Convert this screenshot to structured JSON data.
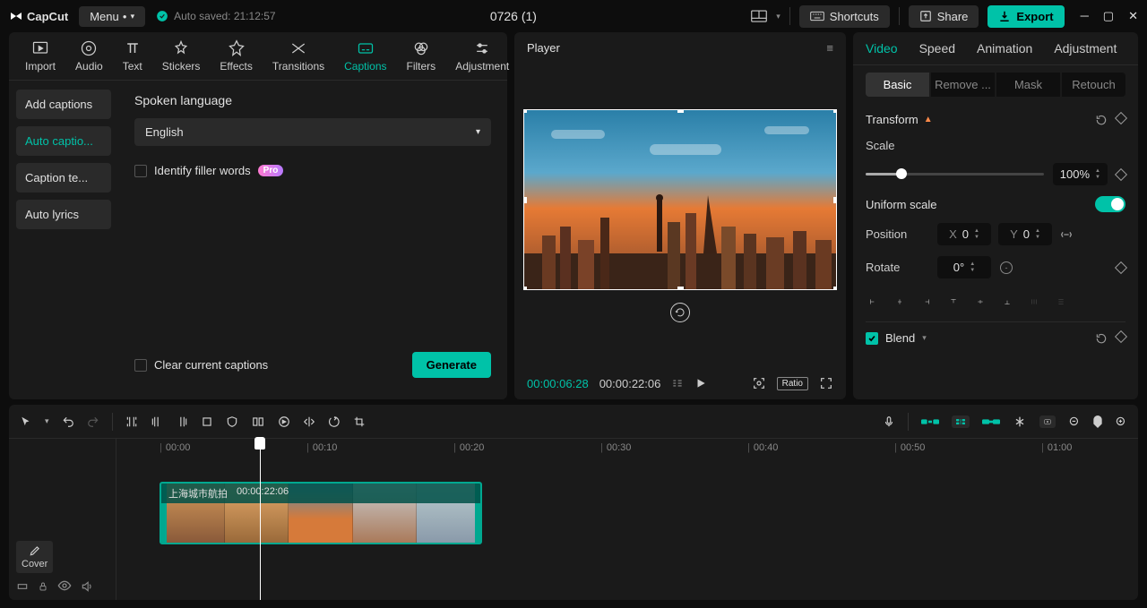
{
  "topbar": {
    "logo_text": "CapCut",
    "menu_label": "Menu",
    "autosave": "Auto saved: 21:12:57",
    "project_title": "0726 (1)",
    "shortcuts": "Shortcuts",
    "share": "Share",
    "export": "Export"
  },
  "media_tabs": [
    "Import",
    "Audio",
    "Text",
    "Stickers",
    "Effects",
    "Transitions",
    "Captions",
    "Filters",
    "Adjustment"
  ],
  "media_tabs_active_index": 6,
  "captions_sidebar": [
    {
      "label": "Add captions"
    },
    {
      "label": "Auto captio..."
    },
    {
      "label": "Caption te..."
    },
    {
      "label": "Auto lyrics"
    }
  ],
  "captions_sidebar_active_index": 1,
  "captions_panel": {
    "spoken_language_label": "Spoken language",
    "language_value": "English",
    "identify_filler_label": "Identify filler words",
    "pro_badge": "Pro",
    "clear_label": "Clear current captions",
    "generate_label": "Generate"
  },
  "player": {
    "title": "Player",
    "current_time": "00:00:06:28",
    "duration": "00:00:22:06",
    "ratio_label": "Ratio"
  },
  "right_tabs": [
    "Video",
    "Speed",
    "Animation",
    "Adjustment"
  ],
  "right_tabs_active_index": 0,
  "sub_tabs": [
    "Basic",
    "Remove ...",
    "Mask",
    "Retouch"
  ],
  "sub_tabs_active_index": 0,
  "transform": {
    "title": "Transform",
    "scale_label": "Scale",
    "scale_value": "100%",
    "uniform_label": "Uniform scale",
    "position_label": "Position",
    "x_label": "X",
    "x_value": "0",
    "y_label": "Y",
    "y_value": "0",
    "rotate_label": "Rotate",
    "rotate_value": "0°",
    "blend_label": "Blend"
  },
  "timeline": {
    "ruler": [
      "00:00",
      "00:10",
      "00:20",
      "00:30",
      "00:40",
      "00:50",
      "01:00"
    ],
    "cover_label": "Cover",
    "clip": {
      "name": "上海城市航拍",
      "duration": "00:00:22:06"
    }
  }
}
